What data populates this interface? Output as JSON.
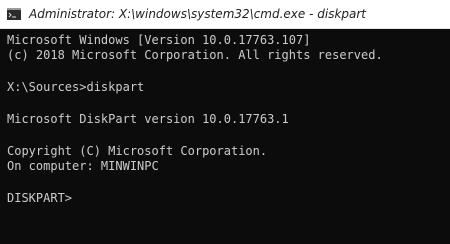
{
  "window": {
    "title": "Administrator: X:\\windows\\system32\\cmd.exe - diskpart",
    "icon": "cmd-icon"
  },
  "console": {
    "lines": [
      "Microsoft Windows [Version 10.0.17763.107]",
      "(c) 2018 Microsoft Corporation. All rights reserved.",
      "X:\\Sources>diskpart",
      "Microsoft DiskPart version 10.0.17763.1",
      "Copyright (C) Microsoft Corporation.",
      "On computer: MINWINPC",
      "DISKPART>"
    ]
  },
  "colors": {
    "console_bg": "#0c0c0c",
    "console_text": "#cccccc"
  }
}
